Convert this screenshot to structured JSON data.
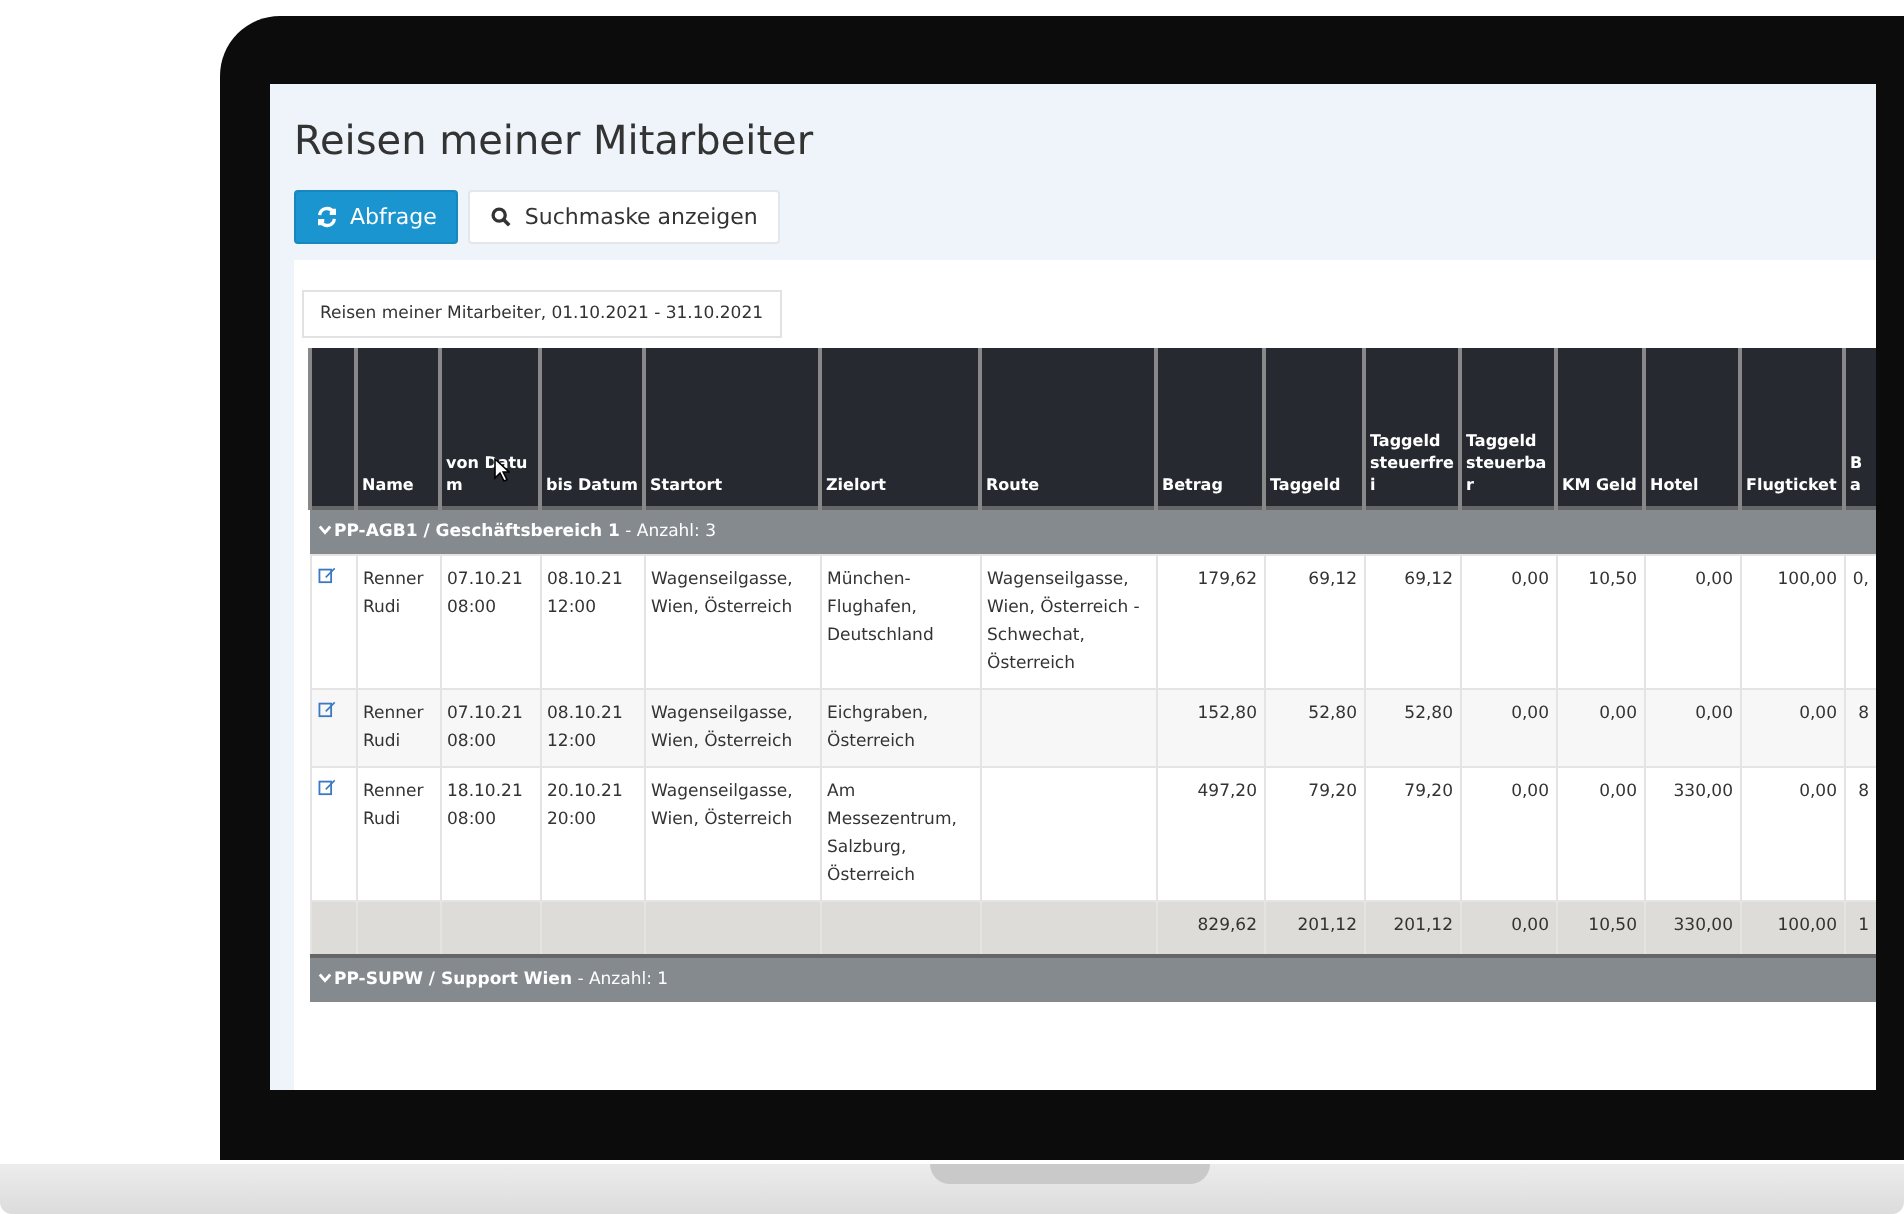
{
  "screen_title": "Reisen meiner Mitarbeiter",
  "buttons": [
    {
      "label": "Abfrage",
      "kind": "primary"
    },
    {
      "label": "Suchmaske anzeigen",
      "kind": "default"
    }
  ],
  "report_caption": "Reisen meiner Mitarbeiter, 01.10.2021 - 31.10.2021",
  "table": {
    "columns": [
      "Name",
      "von Datum",
      "bis Datum",
      "Startort",
      "Zielort",
      "Route",
      "Betrag",
      "Taggeld",
      "Taggeld steuerfrei",
      "Taggeld steuerbar",
      "KM Geld",
      "Hotel",
      "Flugticket",
      "Ba"
    ],
    "groups": [
      {
        "label": "**PP-AGB1 / Geschäftsbereich 1** - Anzahl: 3",
        "rows": [
          {
            "cells": [
              "Renner Rudi",
              "07.10.21 08:00",
              "08.10.21 12:00",
              "Wagenseilgasse, Wien, Österreich",
              "München-Flughafen, Deutschland",
              "Wagenseilgasse, Wien, Österreich - Schwechat, Österreich",
              "179,62",
              "69,12",
              "69,12",
              "0,00",
              "10,50",
              "0,00",
              "100,00",
              "0,"
            ]
          },
          {
            "cells": [
              "Renner Rudi",
              "07.10.21 08:00",
              "08.10.21 12:00",
              "Wagenseilgasse, Wien, Österreich",
              "Eichgraben, Österreich",
              null,
              "152,80",
              "52,80",
              "52,80",
              "0,00",
              "0,00",
              "0,00",
              "0,00",
              "8"
            ]
          },
          {
            "cells": [
              "Renner Rudi",
              "18.10.21 08:00",
              "20.10.21 20:00",
              "Wagenseilgasse, Wien, Österreich",
              "Am Messezentrum, Salzburg, Österreich",
              null,
              "497,20",
              "79,20",
              "79,20",
              "0,00",
              "0,00",
              "330,00",
              "0,00",
              "8"
            ]
          }
        ],
        "totals": [
          "829,62",
          "201,12",
          "201,12",
          "0,00",
          "10,50",
          "330,00",
          "100,00",
          "1"
        ]
      },
      {
        "label": "**PP-SUPW / Support Wien** - Anzahl: 1"
      }
    ]
  }
}
